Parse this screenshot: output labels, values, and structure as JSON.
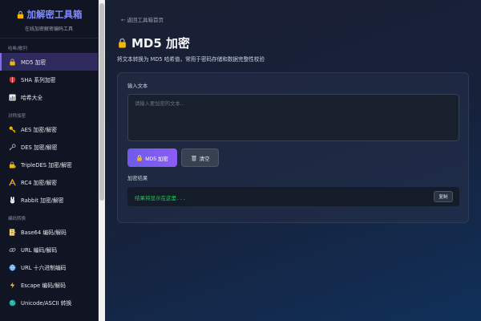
{
  "sidebar": {
    "title": "加解密工具箱",
    "subtitle": "在线加密解密编码工具",
    "sections": [
      {
        "label": "哈希/散列",
        "items": [
          {
            "label": "MD5 加密",
            "icon": "lock-icon",
            "active": true
          },
          {
            "label": "SHA 系列加密",
            "icon": "shield-icon",
            "active": false
          },
          {
            "label": "哈希大全",
            "icon": "bar-chart-icon",
            "active": false
          }
        ]
      },
      {
        "label": "对称加密",
        "items": [
          {
            "label": "AES 加密/解密",
            "icon": "key-icon",
            "active": false
          },
          {
            "label": "DES 加密/解密",
            "icon": "old-key-icon",
            "active": false
          },
          {
            "label": "TripleDES 加密/解密",
            "icon": "locked-key-icon",
            "active": false
          },
          {
            "label": "RC4 加密/解密",
            "icon": "ribbon-icon",
            "active": false
          },
          {
            "label": "Rabbit 加密/解密",
            "icon": "rabbit-icon",
            "active": false
          }
        ]
      },
      {
        "label": "编码转换",
        "items": [
          {
            "label": "Base64 编码/解码",
            "icon": "memo-icon",
            "active": false
          },
          {
            "label": "URL 编码/解码",
            "icon": "link-icon",
            "active": false
          },
          {
            "label": "URL 十六进制编码",
            "icon": "globe-icon",
            "active": false
          },
          {
            "label": "Escape 编码/解码",
            "icon": "lightning-icon",
            "active": false
          },
          {
            "label": "Unicode/ASCII 转换",
            "icon": "globe-icon",
            "active": false
          }
        ]
      }
    ]
  },
  "main": {
    "back_link": "← 返回工具箱首页",
    "title": "MD5 加密",
    "description": "将文本转换为 MD5 哈希值，常用于密码存储和数据完整性校验",
    "input_label": "输入文本",
    "input_placeholder": "请输入要加密的文本...",
    "input_value": "",
    "encrypt_button": "MD5 加密",
    "clear_button": "清空",
    "result_label": "加密结果",
    "result_placeholder": "结果将显示在这里...",
    "copy_button": "复制"
  },
  "colors": {
    "accent": "#7c6cf0",
    "result_text": "#22c55e",
    "brand": "#818cf8"
  }
}
